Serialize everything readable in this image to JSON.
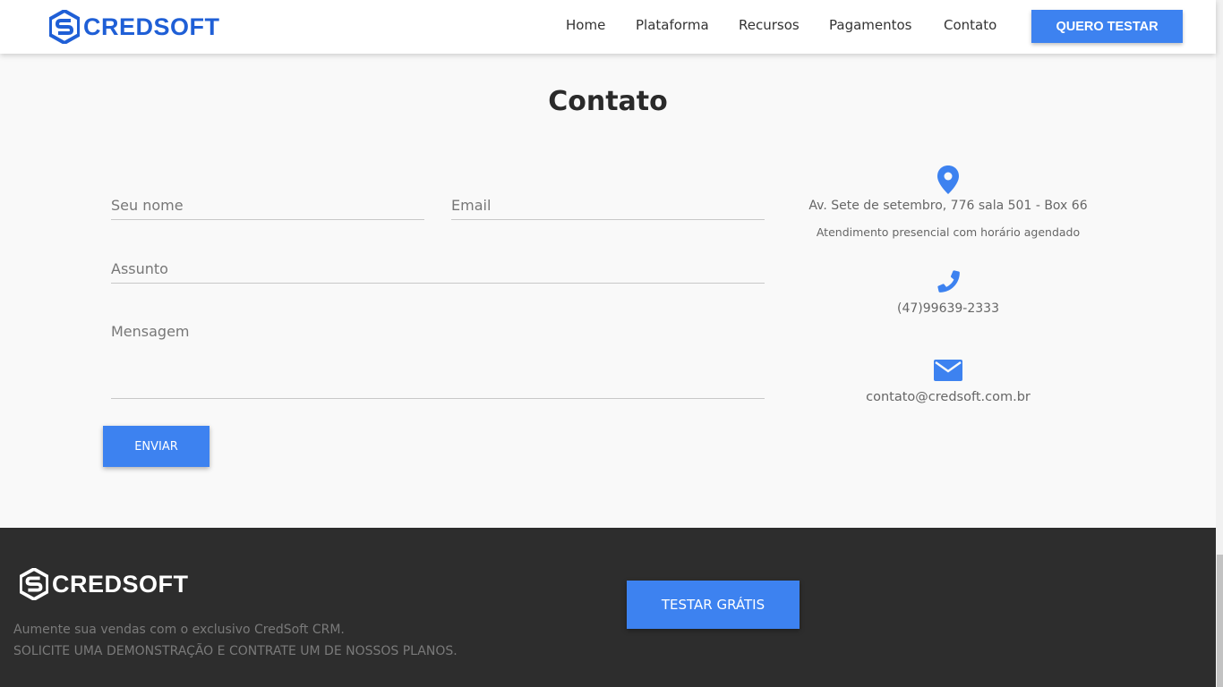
{
  "header": {
    "brand": "CREDSOFT",
    "nav": [
      "Home",
      "Plataforma",
      "Recursos",
      "Pagamentos",
      "Contato"
    ],
    "cta": "QUERO TESTAR"
  },
  "contact": {
    "title": "Contato",
    "form": {
      "name_placeholder": "Seu nome",
      "email_placeholder": "Email",
      "subject_placeholder": "Assunto",
      "message_placeholder": "Mensagem",
      "submit": "ENVIAR"
    },
    "info": {
      "address": "Av. Sete de setembro, 776 sala 501 - Box 66",
      "address_note": "Atendimento presencial com horário agendado",
      "phone": "(47)99639-2333",
      "email": "contato@credsoft.com.br"
    }
  },
  "footer": {
    "brand": "CREDSOFT",
    "line1": "Aumente sua vendas com o exclusivo CredSoft CRM.",
    "line2": "SOLICITE UMA DEMONSTRAÇÃO E CONTRATE UM DE NOSSOS PLANOS.",
    "cta": "TESTAR GRÁTIS"
  },
  "colors": {
    "accent": "#3d82f0",
    "brand_blue": "#1f5fd6",
    "footer_bg": "#2d2d2d",
    "page_bg": "#f9f9f9"
  }
}
